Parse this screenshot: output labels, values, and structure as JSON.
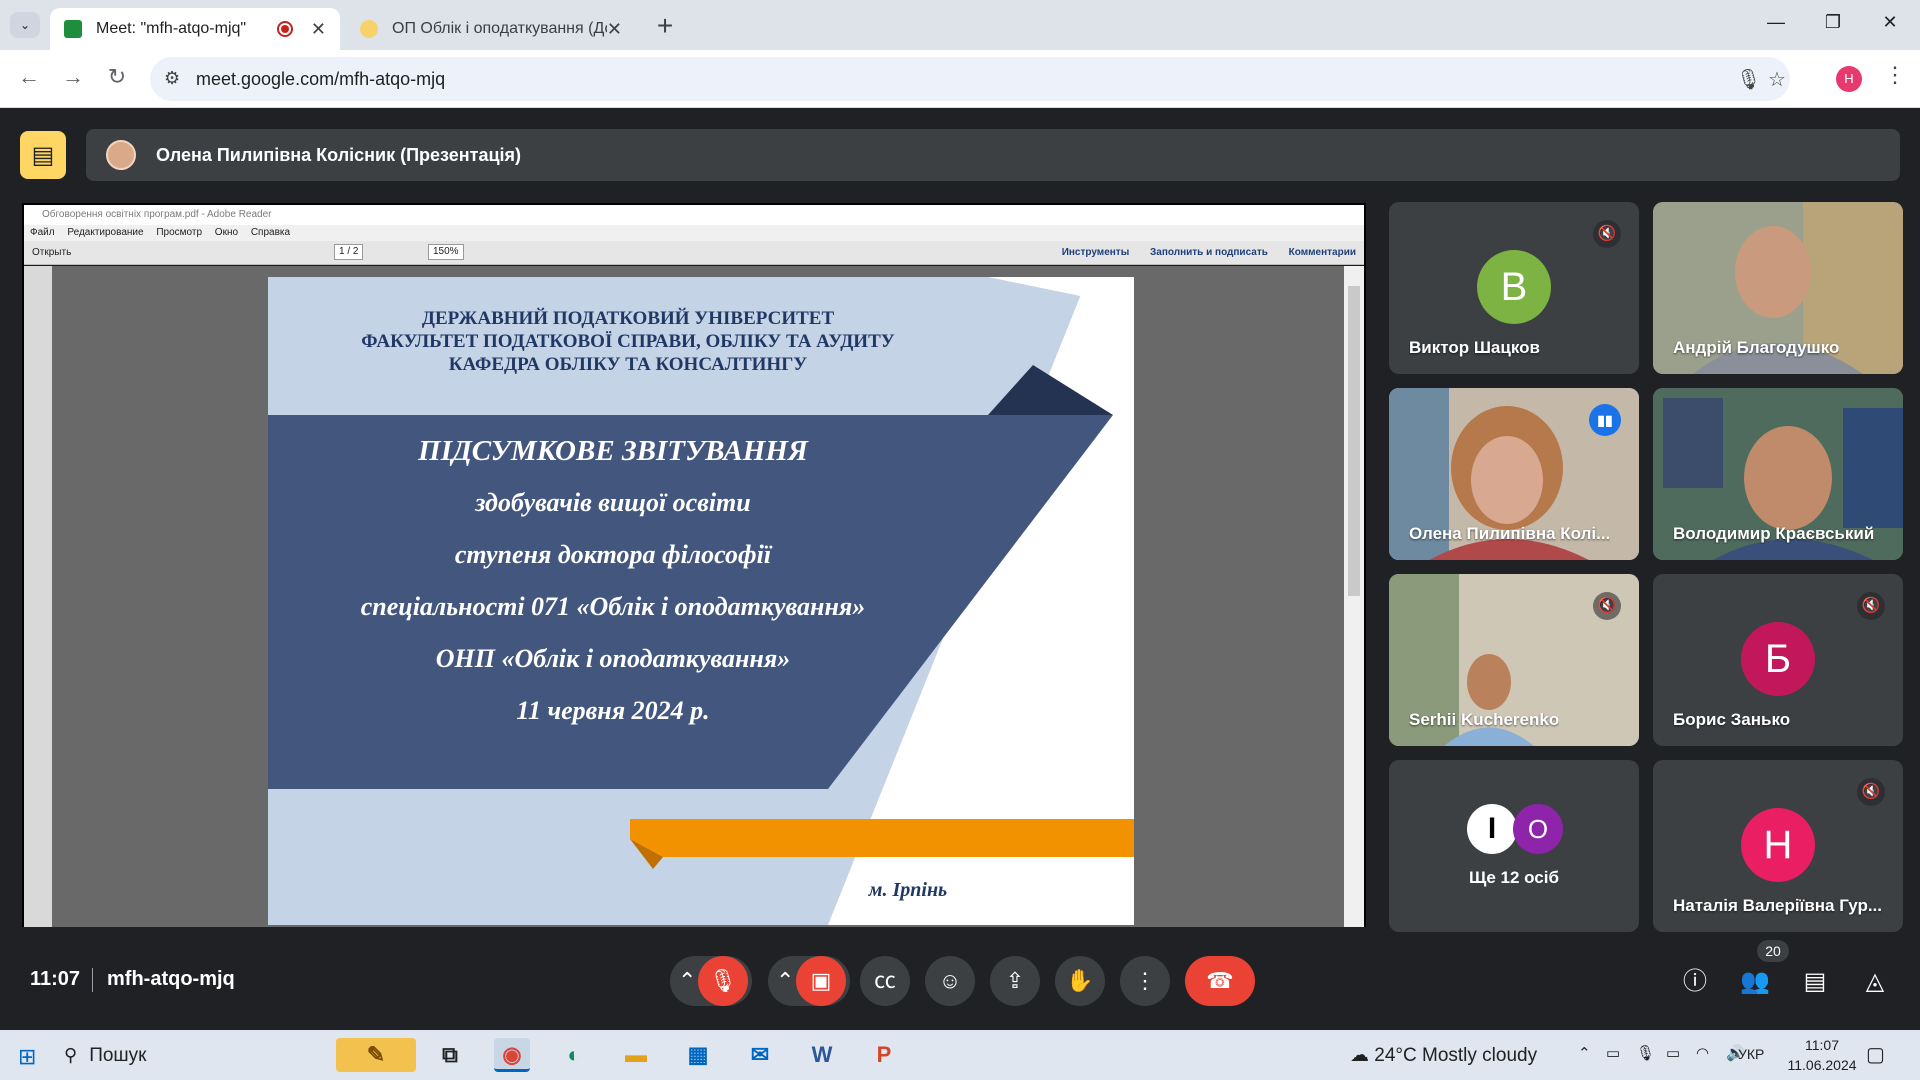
{
  "browser": {
    "tabs_menu_icon": "chevron-down-icon",
    "tabs": [
      {
        "title": "Meet: \"mfh-atqo-mjq\"",
        "active": true,
        "favicon_color": "#1e8e3e"
      },
      {
        "title": "ОП Облік і оподаткування (Докт",
        "active": false,
        "favicon_color": "#fbbc04"
      }
    ],
    "new_tab": "+",
    "window_controls": {
      "minimize": "—",
      "restore": "❐",
      "close": "✕"
    },
    "url": "meet.google.com/mfh-atqo-mjq",
    "profile_initial": "H"
  },
  "meet": {
    "presenter_label": "Олена Пилипівна Колісник (Презентація)",
    "time": "11:07",
    "meeting_code": "mfh-atqo-mjq",
    "participant_count": "20",
    "participants": [
      {
        "name": "Виктор Шацков",
        "initial": "B",
        "color": "#34a853",
        "muted": true,
        "video": false
      },
      {
        "name": "Андрій Благодушко",
        "muted": false,
        "video": true
      },
      {
        "name": "Олена Пилипівна Колі...",
        "muted": false,
        "video": true,
        "speaking": true
      },
      {
        "name": "Володимир Краєвський",
        "muted": false,
        "video": true
      },
      {
        "name": "Serhii Kucherenko",
        "muted": true,
        "video": true
      },
      {
        "name": "Борис Занько",
        "initial": "Б",
        "color": "#c2185b",
        "muted": true,
        "video": false
      },
      {
        "name": "Наталія Валеріївна Гур...",
        "initial": "Н",
        "color": "#d81b60",
        "muted": true,
        "video": false
      }
    ],
    "others": {
      "label": "Ще 12 осіб",
      "avatar1": "I",
      "avatar2": "O"
    }
  },
  "reader": {
    "title": "Обговорення освітніх програм.pdf - Adobe Reader",
    "menu": [
      "Файл",
      "Редактирование",
      "Просмотр",
      "Окно",
      "Справка"
    ],
    "open_label": "Открыть",
    "page_current": "1",
    "page_total": "/ 2",
    "zoom": "150%",
    "right_tools": [
      "Инструменты",
      "Заполнить и подписать",
      "Комментарии"
    ]
  },
  "slide": {
    "header": [
      "ДЕРЖАВНИЙ ПОДАТКОВИЙ УНІВЕРСИТЕТ",
      "ФАКУЛЬТЕТ ПОДАТКОВОЇ СПРАВИ, ОБЛІКУ ТА АУДИТУ",
      "КАФЕДРА ОБЛІКУ ТА КОНСАЛТИНГУ"
    ],
    "lines": [
      "ПІДСУМКОВЕ ЗВІТУВАННЯ",
      "здобувачів вищої освіти",
      "ступеня доктора філософії",
      "спеціальності 071 «Облік і оподаткування»",
      "ОНП «Облік і оподаткування»",
      "11 червня 2024 р."
    ],
    "city": "м. Ірпінь"
  },
  "taskbar": {
    "search_label": "Пошук",
    "weather": "24°C  Mostly cloudy",
    "language": "УКР",
    "time": "11:07",
    "date": "11.06.2024"
  }
}
